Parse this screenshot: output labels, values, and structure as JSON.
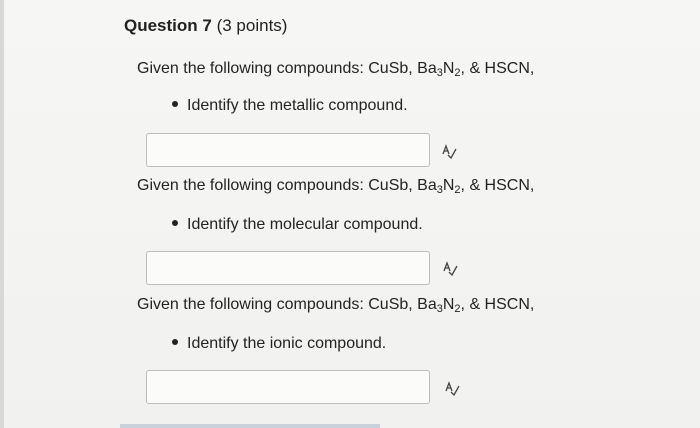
{
  "question": {
    "title": "Question 7",
    "points": "(3 points)"
  },
  "parts": [
    {
      "prompt_prefix": "Given the following compounds:  CuSb, Ba",
      "prompt_sub1": "3",
      "prompt_mid": "N",
      "prompt_sub2": "2",
      "prompt_suffix": ", & HSCN,",
      "bullet": "Identify the metallic compound.",
      "answer_value": ""
    },
    {
      "prompt_prefix": "Given the following compounds:  CuSb, Ba",
      "prompt_sub1": "3",
      "prompt_mid": "N",
      "prompt_sub2": "2",
      "prompt_suffix": ", & HSCN,",
      "bullet": "Identify the molecular compound.",
      "answer_value": ""
    },
    {
      "prompt_prefix": "Given the following compounds:  CuSb, Ba",
      "prompt_sub1": "3",
      "prompt_mid": "N",
      "prompt_sub2": "2",
      "prompt_suffix": ", & HSCN,",
      "bullet": "Identify the ionic compound.",
      "answer_value": ""
    }
  ]
}
